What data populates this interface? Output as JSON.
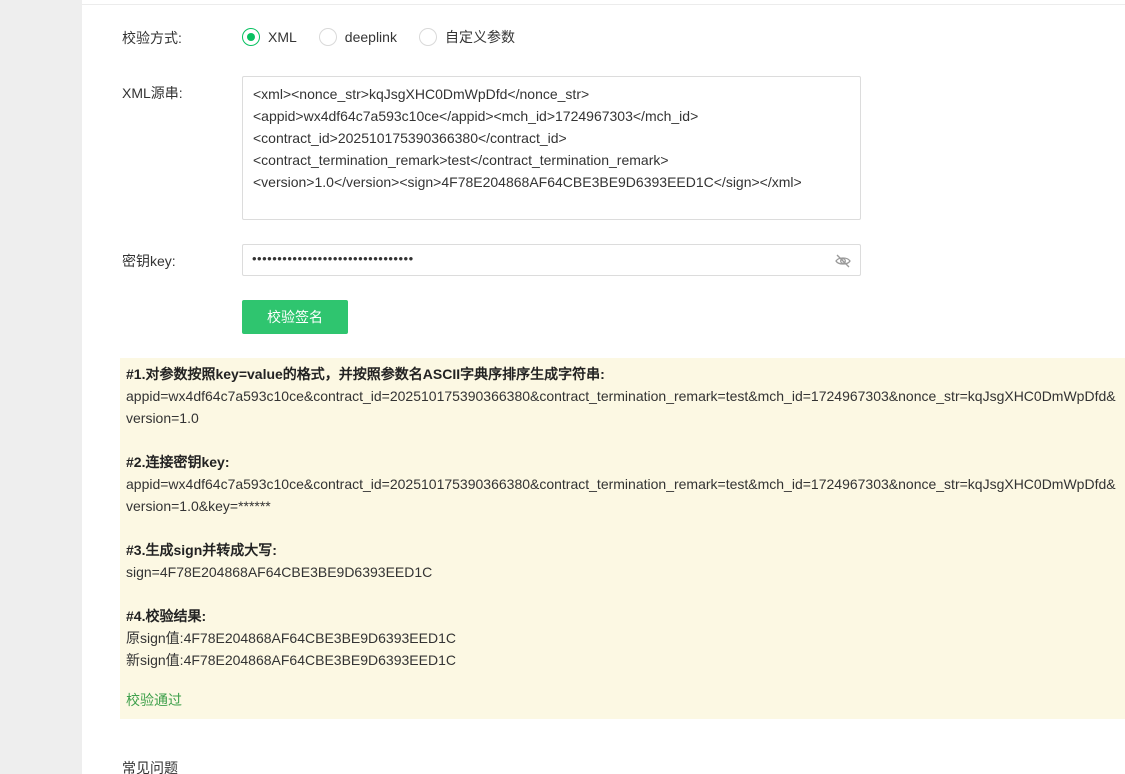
{
  "form": {
    "method_label": "校验方式:",
    "methods": [
      {
        "label": "XML",
        "checked": true
      },
      {
        "label": "deeplink",
        "checked": false
      },
      {
        "label": "自定义参数",
        "checked": false
      }
    ],
    "xml_label": "XML源串:",
    "xml_lines": [
      "<xml><nonce_str>kqJsgXHC0DmWpDfd</nonce_str>",
      "<appid>wx4df64c7a593c10ce</appid><mch_id>1724967303</mch_id>",
      "<contract_id>202510175390366380</contract_id>",
      "<contract_termination_remark>test</contract_termination_remark>",
      "<version>1.0</version><sign>4F78E204868AF64CBE3BE9D6393EED1C</sign></xml>"
    ],
    "key_label": "密钥key:",
    "key_value": "••••••••••••••••••••••••••••••••",
    "verify_button": "校验签名"
  },
  "result": {
    "step1_title": "#1.对参数按照key=value的格式，并按照参数名ASCII字典序排序生成字符串:",
    "step1_text": "appid=wx4df64c7a593c10ce&contract_id=202510175390366380&contract_termination_remark=test&mch_id=1724967303&nonce_str=kqJsgXHC0DmWpDfd&version=1.0",
    "step2_title": "#2.连接密钥key:",
    "step2_text": "appid=wx4df64c7a593c10ce&contract_id=202510175390366380&contract_termination_remark=test&mch_id=1724967303&nonce_str=kqJsgXHC0DmWpDfd&version=1.0&key=******",
    "step3_title": "#3.生成sign并转成大写:",
    "step3_text": "sign=4F78E204868AF64CBE3BE9D6393EED1C",
    "step4_title": "#4.校验结果:",
    "original_sign": "原sign值:4F78E204868AF64CBE3BE9D6393EED1C",
    "new_sign": "新sign值:4F78E204868AF64CBE3BE9D6393EED1C",
    "status": "校验通过"
  },
  "faq": {
    "heading": "常见问题"
  },
  "colors": {
    "accent": "#07c160",
    "button": "#2fc56f",
    "panel_bg": "#fcf8e3",
    "success_text": "#3ea04b"
  },
  "icons": {
    "key_visibility": "eye-off-icon"
  }
}
